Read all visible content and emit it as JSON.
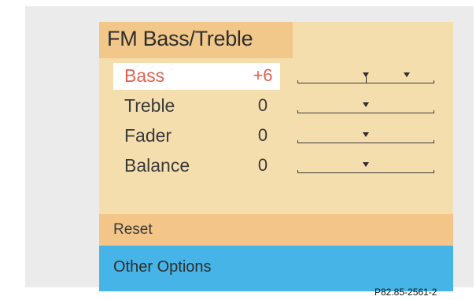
{
  "menu": {
    "title": "FM Bass/Treble",
    "rows": [
      {
        "label": "Bass",
        "value": "+6",
        "level": 6,
        "selected": true
      },
      {
        "label": "Treble",
        "value": "0",
        "level": 0,
        "selected": false
      },
      {
        "label": "Fader",
        "value": "0",
        "level": 0,
        "selected": false
      },
      {
        "label": "Balance",
        "value": "0",
        "level": 0,
        "selected": false
      }
    ],
    "reset_label": "Reset",
    "other_options_label": "Other Options"
  },
  "reference_code": "P82.85-2561-2",
  "slider_range": {
    "min": -10,
    "max": 10
  },
  "colors": {
    "panel_background": "#f5deae",
    "title_tab": "#f2c78a",
    "reset_bar": "#f4c588",
    "other_options_bar": "#46b4e6",
    "selected_text": "#e0624e",
    "selected_background": "#ffffff"
  }
}
